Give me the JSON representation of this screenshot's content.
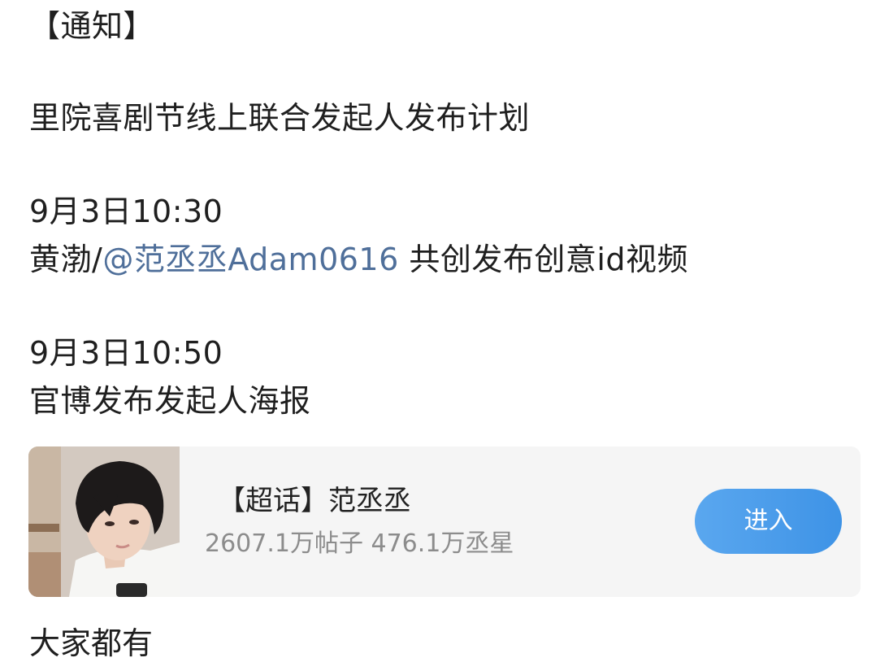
{
  "post": {
    "line1": "【通知】",
    "line2": "里院喜剧节线上联合发起人发布计划",
    "line3": "9月3日10:30",
    "line4_prefix": "黄渤/",
    "line4_mention": "@范丞丞Adam0616",
    "line4_suffix": " 共创发布创意id视频",
    "line5": "9月3日10:50",
    "line6": "官博发布发起人海报",
    "trailing_text": "大家都有"
  },
  "card": {
    "title": "【超话】范丞丞",
    "stats": "2607.1万帖子 476.1万丞星",
    "button_label": "进入"
  },
  "colors": {
    "mention": "#4f6f9a",
    "button_start": "#5aa7ef",
    "button_end": "#3e93e6",
    "card_bg": "#f5f5f5"
  },
  "icons": {
    "card_image": "supertopic-avatar-photo"
  }
}
